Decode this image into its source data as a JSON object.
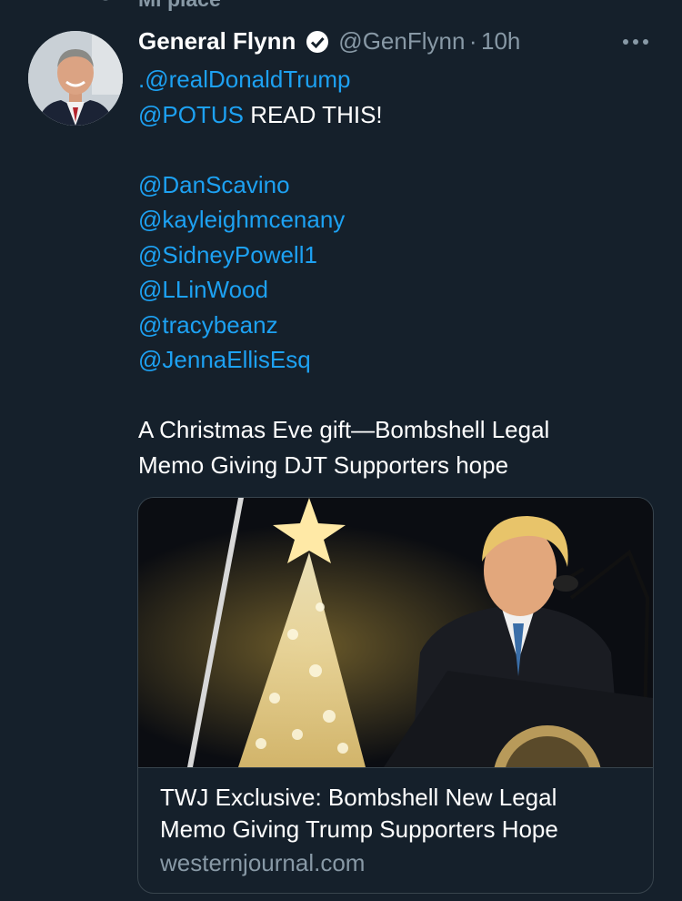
{
  "activity": {
    "label": "Mi piace"
  },
  "tweet": {
    "author_name": "General Flynn",
    "handle": "@GenFlynn",
    "separator": "·",
    "time": "10h",
    "lines": {
      "l1": ".@realDonaldTrump",
      "l2_mention": "@POTUS",
      "l2_text": " READ THIS!",
      "m1": "@DanScavino",
      "m2": "@kayleighmcenany",
      "m3": "@SidneyPowell1",
      "m4": "@LLinWood",
      "m5": "@tracybeanz",
      "m6": "@JennaEllisEsq",
      "p1": "A Christmas Eve gift—Bombshell Legal",
      "p2": "Memo Giving DJT Supporters hope"
    }
  },
  "card": {
    "title_line1": "TWJ Exclusive: Bombshell New Legal",
    "title_line2": "Memo Giving Trump Supporters Hope",
    "domain": "westernjournal.com"
  },
  "colors": {
    "background": "#15202b",
    "link": "#1da1f2",
    "secondary": "#8899a6",
    "border": "#38444d"
  }
}
